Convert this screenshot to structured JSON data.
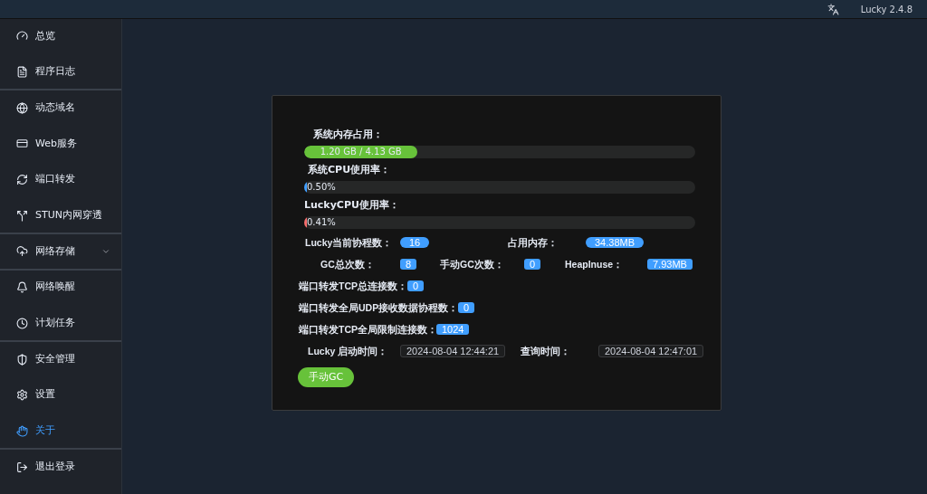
{
  "top_bar": {
    "version": "Lucky 2.4.8"
  },
  "sidebar": {
    "items": [
      {
        "label": "总览",
        "selected": false,
        "divider": false
      },
      {
        "label": "程序日志",
        "selected": false,
        "divider": true
      },
      {
        "label": "动态域名",
        "selected": false,
        "divider": false
      },
      {
        "label": "Web服务",
        "selected": false,
        "divider": false
      },
      {
        "label": "端口转发",
        "selected": false,
        "divider": false
      },
      {
        "label": "STUN内网穿透",
        "selected": false,
        "divider": true
      },
      {
        "label": "网络存储",
        "selected": false,
        "divider": true,
        "expanded": false
      },
      {
        "label": "网络唤醒",
        "selected": false,
        "divider": false
      },
      {
        "label": "计划任务",
        "selected": false,
        "divider": true
      },
      {
        "label": "安全管理",
        "selected": false,
        "divider": false
      },
      {
        "label": "设置",
        "selected": false,
        "divider": false
      },
      {
        "label": "关于",
        "selected": true,
        "divider": true
      },
      {
        "label": "退出登录",
        "selected": false,
        "divider": false
      }
    ]
  },
  "meters": [
    {
      "label": "系统内存占用：",
      "reading": "1.20 GB / 4.13 GB",
      "level": 0.29,
      "color": "#67c23a"
    },
    {
      "label": "系统CPU使用率：",
      "reading": "0.50%",
      "level": 0.005,
      "color": "#409eff"
    },
    {
      "label": "LuckyCPU使用率：",
      "reading": "0.41%",
      "level": 0.004,
      "color": "#f56c6c"
    }
  ],
  "stats": [
    {
      "items": [
        {
          "label": "Lucky当前协程数：",
          "value": "16",
          "kind": "pill"
        },
        {
          "label": "占用内存：",
          "value": "34.38MB",
          "kind": "pill"
        }
      ]
    },
    {
      "items": [
        {
          "label": "GC总次数：",
          "value": "8",
          "kind": "tag"
        },
        {
          "label": "手动GC次数：",
          "value": "0",
          "kind": "tag"
        },
        {
          "label": "HeapInuse：",
          "value": "7.93MB",
          "kind": "tag"
        }
      ]
    },
    {
      "items": [
        {
          "label": "端口转发TCP总连接数：",
          "value": "0",
          "kind": "tag"
        }
      ]
    },
    {
      "items": [
        {
          "label": "端口转发全局UDP接收数据协程数：",
          "value": "0",
          "kind": "tag"
        }
      ]
    },
    {
      "items": [
        {
          "label": "端口转发TCP全局限制连接数：",
          "value": "1024",
          "kind": "tag"
        }
      ]
    },
    {
      "items": [
        {
          "label": "Lucky 启动时间：",
          "value": "2024-08-04 12:44:21",
          "kind": "time"
        },
        {
          "label": "查询时间：",
          "value": "2024-08-04 12:47:01",
          "kind": "time"
        }
      ]
    }
  ],
  "button": "手动GC"
}
